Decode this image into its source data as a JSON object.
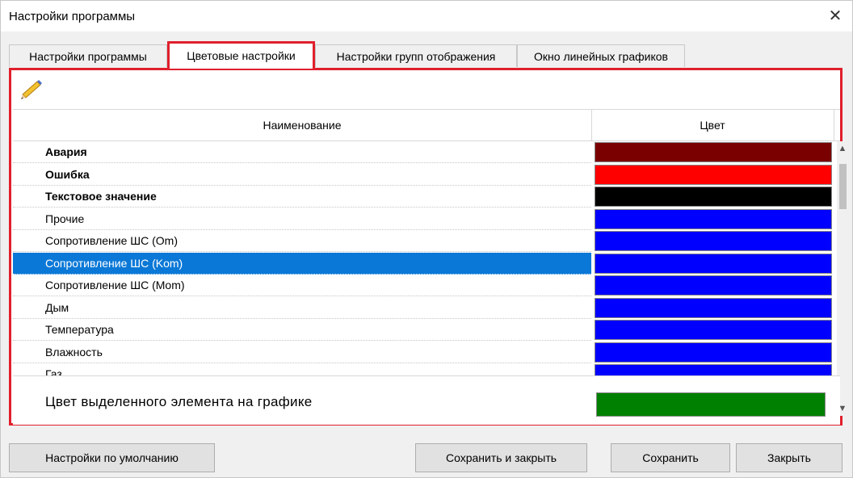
{
  "window": {
    "title": "Настройки программы",
    "close_glyph": "✕"
  },
  "tabs": [
    {
      "label": "Настройки программы"
    },
    {
      "label": "Цветовые настройки",
      "active": true
    },
    {
      "label": "Настройки групп отображения"
    },
    {
      "label": "Окно линейных графиков"
    }
  ],
  "toolbar": {
    "icon": "pencil-icon"
  },
  "grid": {
    "col_name": "Наименование",
    "col_color": "Цвет",
    "rows": [
      {
        "label": "Авария",
        "color": "#7a0000",
        "bold": true
      },
      {
        "label": "Ошибка",
        "color": "#ff0000",
        "bold": true
      },
      {
        "label": "Текстовое значение",
        "color": "#000000",
        "bold": true
      },
      {
        "label": "Прочие",
        "color": "#0000ff"
      },
      {
        "label": "Сопротивление ШС (Om)",
        "color": "#0000ff"
      },
      {
        "label": "Сопротивление ШС (Kom)",
        "color": "#0000ff",
        "selected": true
      },
      {
        "label": "Сопротивление ШС (Mom)",
        "color": "#0000ff"
      },
      {
        "label": "Дым",
        "color": "#0000ff"
      },
      {
        "label": "Температура",
        "color": "#0000ff"
      },
      {
        "label": "Влажность",
        "color": "#0000ff"
      },
      {
        "label": "Газ",
        "color": "#0000ff"
      }
    ]
  },
  "selected_element": {
    "label": "Цвет выделенного элемента на графике",
    "color": "#008000"
  },
  "buttons": {
    "defaults": "Настройки по умолчанию",
    "save_close": "Сохранить и закрыть",
    "save": "Сохранить",
    "close": "Закрыть"
  },
  "colors": {
    "accent_border": "#e0202c",
    "selection": "#0a78d7"
  }
}
